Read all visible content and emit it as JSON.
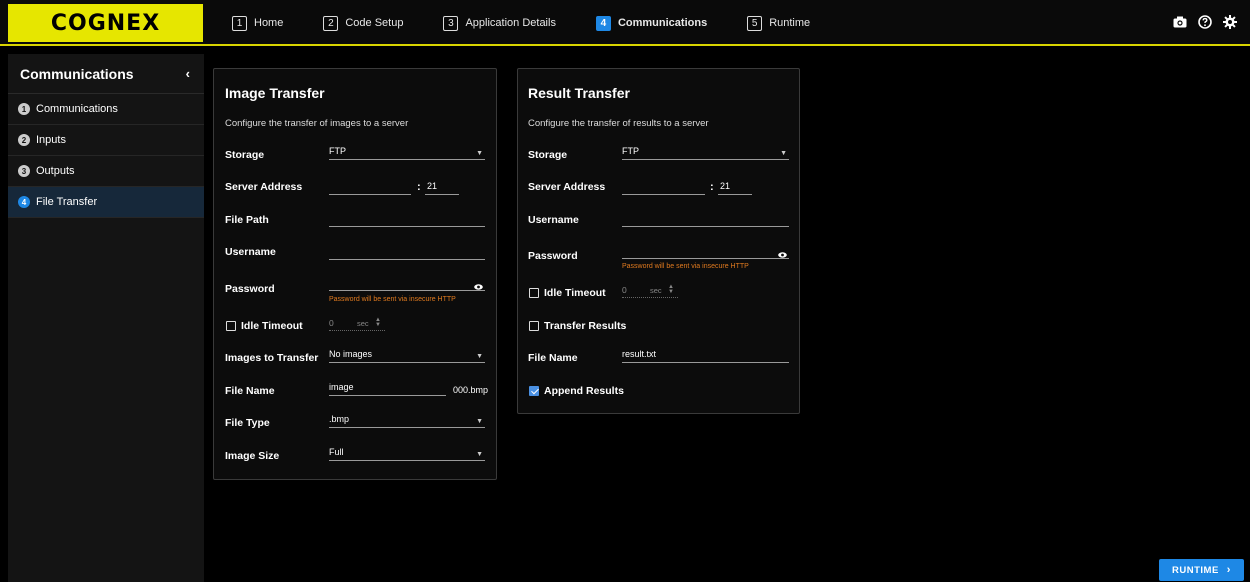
{
  "header": {
    "logo": "COGNEX",
    "steps": [
      {
        "num": "1",
        "label": "Home"
      },
      {
        "num": "2",
        "label": "Code Setup"
      },
      {
        "num": "3",
        "label": "Application Details"
      },
      {
        "num": "4",
        "label": "Communications",
        "active": true
      },
      {
        "num": "5",
        "label": "Runtime"
      }
    ],
    "icons": [
      "camera-icon",
      "help-icon",
      "settings-icon"
    ]
  },
  "sidebar": {
    "title": "Communications",
    "collapse_glyph": "‹",
    "items": [
      {
        "num": "1",
        "label": "Communications"
      },
      {
        "num": "2",
        "label": "Inputs"
      },
      {
        "num": "3",
        "label": "Outputs"
      },
      {
        "num": "4",
        "label": "File Transfer",
        "active": true
      }
    ]
  },
  "image_transfer": {
    "title": "Image Transfer",
    "description": "Configure the transfer of images to a server",
    "storage_label": "Storage",
    "storage_value": "FTP",
    "server_address_label": "Server Address",
    "server_address_value": "",
    "colon": ":",
    "port_value": "21",
    "file_path_label": "File Path",
    "file_path_value": "",
    "username_label": "Username",
    "username_value": "",
    "password_label": "Password",
    "password_value": "",
    "password_warning": "Password will be sent via insecure HTTP",
    "idle_timeout_label": "Idle Timeout",
    "idle_timeout_checked": false,
    "idle_timeout_value": "0",
    "idle_timeout_unit": "sec",
    "images_to_transfer_label": "Images to Transfer",
    "images_to_transfer_value": "No images",
    "file_name_label": "File Name",
    "file_name_value": "image",
    "file_name_suffix": "000.bmp",
    "file_type_label": "File Type",
    "file_type_value": ".bmp",
    "image_size_label": "Image Size",
    "image_size_value": "Full"
  },
  "result_transfer": {
    "title": "Result Transfer",
    "description": "Configure the transfer of results to a server",
    "storage_label": "Storage",
    "storage_value": "FTP",
    "server_address_label": "Server Address",
    "server_address_value": "",
    "colon": ":",
    "port_value": "21",
    "username_label": "Username",
    "username_value": "",
    "password_label": "Password",
    "password_value": "",
    "password_warning": "Password will be sent via insecure HTTP",
    "idle_timeout_label": "Idle Timeout",
    "idle_timeout_checked": false,
    "idle_timeout_value": "0",
    "idle_timeout_unit": "sec",
    "transfer_results_label": "Transfer Results",
    "transfer_results_checked": false,
    "file_name_label": "File Name",
    "file_name_value": "result.txt",
    "append_results_label": "Append Results",
    "append_results_checked": true
  },
  "footer": {
    "runtime_button": "RUNTIME",
    "runtime_chevron": "›"
  },
  "colors": {
    "accent": "#1e88e5",
    "brand_yellow": "#e6e600",
    "warning": "#e07a1f"
  }
}
